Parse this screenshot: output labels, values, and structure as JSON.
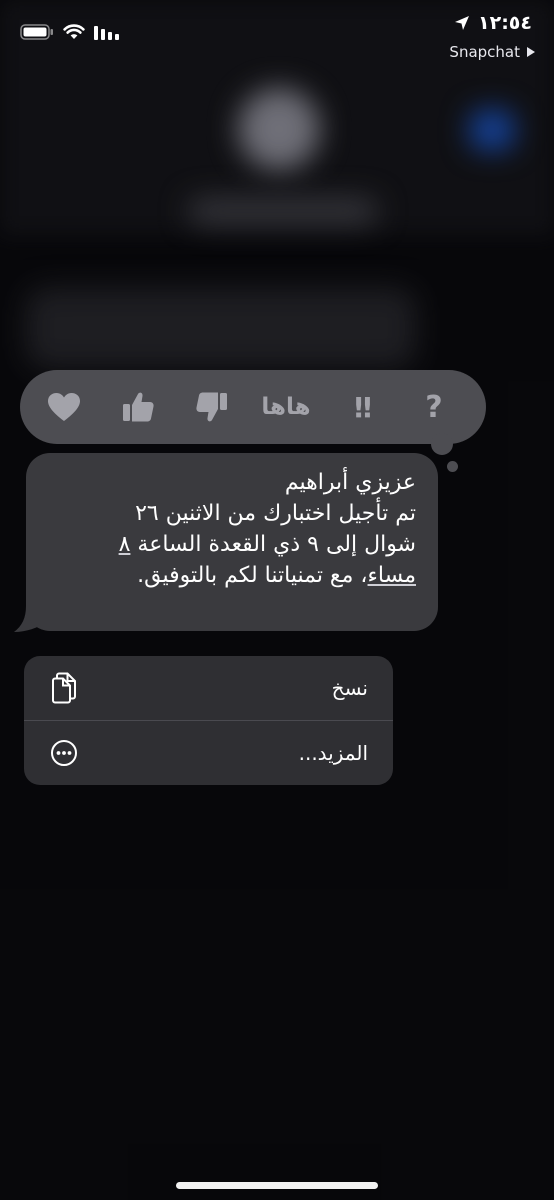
{
  "status_bar": {
    "time": "١٢:٥٤",
    "back_app": "Snapchat",
    "icons": [
      "battery-icon",
      "wifi-icon",
      "signal-icon",
      "location-arrow-icon",
      "back-triangle-icon"
    ]
  },
  "tapback": {
    "items": [
      {
        "name": "heart",
        "icon": "heart-icon"
      },
      {
        "name": "thumbs-up",
        "icon": "thumbs-up-icon"
      },
      {
        "name": "thumbs-down",
        "icon": "thumbs-down-icon"
      },
      {
        "name": "haha",
        "label": "ها‌ها"
      },
      {
        "name": "emphasize",
        "label": "‼"
      },
      {
        "name": "question",
        "label": "?"
      }
    ]
  },
  "message": {
    "lines": [
      "عزيزي أبراهيم",
      " تم تأجيل اختبارك من الاثنين ٢٦",
      "شوال إلى ٩ ذي القعدة الساعة ",
      "، مع تمنياتنا لكم بالتوفيق."
    ],
    "link_part1": "٨",
    "link_part2": "مساء"
  },
  "menu": {
    "items": [
      {
        "label": "نسخ",
        "icon": "copy-icon"
      },
      {
        "label": "المزيد...",
        "icon": "more-ellipsis-icon"
      }
    ]
  },
  "colors": {
    "background": "#0b0b0f",
    "bubble": "#3a3a3e",
    "tapback": "#4d4d52",
    "menu": "#2f2f33",
    "icon_gray": "#a3a3aa"
  }
}
